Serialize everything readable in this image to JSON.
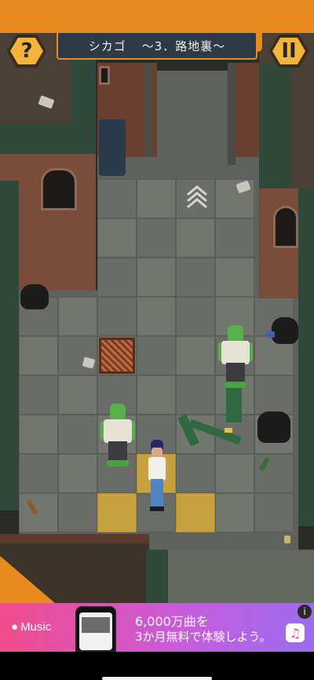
{
  "hud": {
    "help_label": "?",
    "pause_label": "II",
    "stage_city": "シカゴ",
    "stage_name": "〜3．路地裏〜"
  },
  "colors": {
    "accent_orange": "#e88a1e",
    "title_panel": "#2d3a4a",
    "highlight_tile": "#c7a13e",
    "zombie_skin": "#58b04d"
  },
  "ad": {
    "brand": "Music",
    "headline": "6,000万曲を",
    "subline": "3か月無料で体験しよう。",
    "info_label": "i",
    "app_icon": "music-note-icon"
  }
}
